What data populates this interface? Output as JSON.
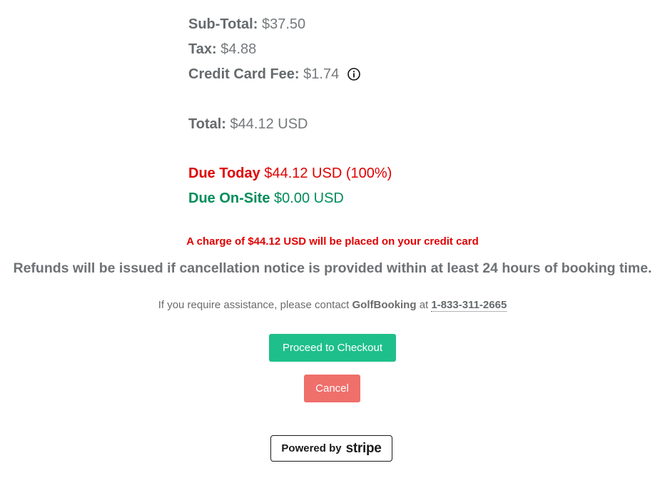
{
  "summary": {
    "subtotal_label": "Sub-Total:",
    "subtotal_value": "$37.50",
    "tax_label": "Tax:",
    "tax_value": "$4.88",
    "fee_label": "Credit Card Fee:",
    "fee_value": "$1.74",
    "total_label": "Total:",
    "total_value": "$44.12 USD",
    "due_today_label": "Due Today",
    "due_today_value": "$44.12 USD (100%)",
    "due_onsite_label": "Due On-Site",
    "due_onsite_value": "$0.00 USD"
  },
  "notices": {
    "charge": "A charge of $44.12 USD will be placed on your credit card",
    "refund": "Refunds will be issued if cancellation notice is provided within at least 24 hours of booking time."
  },
  "assist": {
    "prefix": "If you require assistance, please contact",
    "company": "GolfBooking",
    "at": "at",
    "phone": "1-833-311-2665"
  },
  "actions": {
    "checkout_label": "Proceed to Checkout",
    "cancel_label": "Cancel"
  },
  "stripe": {
    "powered_by": "Powered by",
    "brand": "stripe"
  },
  "colors": {
    "due_today": "#e00000",
    "due_onsite": "#008c5a",
    "checkout_button": "#1fbf8b",
    "cancel_button": "#ef6f6b"
  },
  "icons": {
    "fee_info": "info-circle-icon"
  }
}
